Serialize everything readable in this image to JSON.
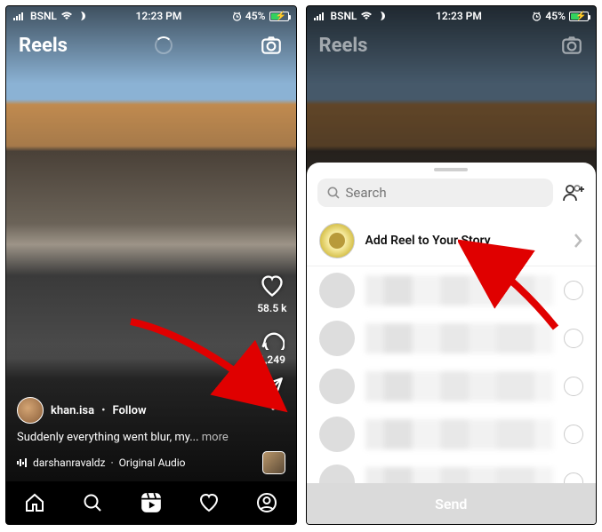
{
  "status": {
    "carrier": "BSNL",
    "time": "12:23 PM",
    "battery_pct": "45%"
  },
  "header": {
    "title": "Reels"
  },
  "rail": {
    "likes": "58.5 k",
    "comments": "1,249"
  },
  "post": {
    "username": "khan.isa",
    "follow_label": "Follow",
    "caption": "Suddenly everything went blur, my...",
    "more_label": "more",
    "audio_user": "darshanravaldz",
    "audio_track": "Original Audio"
  },
  "sheet": {
    "search_placeholder": "Search",
    "story_label": "Add Reel to Your Story",
    "send_label": "Send"
  }
}
